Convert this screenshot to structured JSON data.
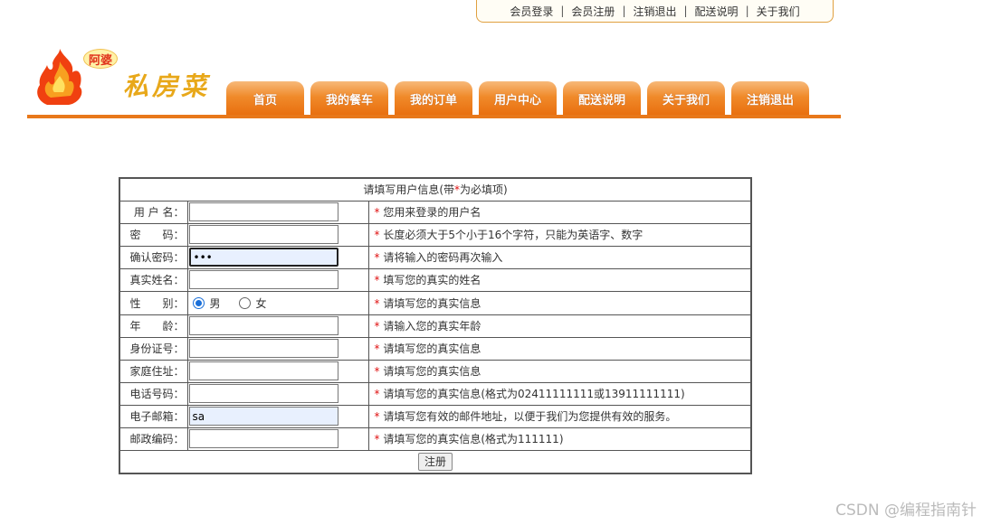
{
  "toplinks": [
    "会员登录",
    "会员注册",
    "注销退出",
    "配送说明",
    "关于我们"
  ],
  "toplink_sep": "|",
  "logo": {
    "tag": "阿婆",
    "name": "私房菜"
  },
  "nav": [
    "首页",
    "我的餐车",
    "我的订单",
    "用户中心",
    "配送说明",
    "关于我们",
    "注销退出"
  ],
  "form": {
    "caption_pre": "请填写用户信息(带",
    "caption_star": "*",
    "caption_post": "为必填项)",
    "star": "*",
    "rows": [
      {
        "label": "用 户 名：",
        "value": "",
        "hint": "您用来登录的用户名"
      },
      {
        "label": "密　　码：",
        "value": "",
        "hint": "长度必须大于5个小于16个字符，只能为英语字、数字"
      },
      {
        "label": "确认密码：",
        "value": "•••",
        "hint": "请将输入的密码再次输入"
      },
      {
        "label": "真实姓名：",
        "value": "",
        "hint": "填写您的真实的姓名"
      },
      {
        "label": "性　　别：",
        "hint": "请填写您的真实信息"
      },
      {
        "label": "年　　龄：",
        "value": "",
        "hint": "请输入您的真实年龄"
      },
      {
        "label": "身份证号：",
        "value": "",
        "hint": "请填写您的真实信息"
      },
      {
        "label": "家庭住址：",
        "value": "",
        "hint": "请填写您的真实信息"
      },
      {
        "label": "电话号码：",
        "value": "",
        "hint": "请填写您的真实信息(格式为02411111111或13911111111)"
      },
      {
        "label": "电子邮箱：",
        "value": "sa",
        "hint": "请填写您有效的邮件地址，以便于我们为您提供有效的服务。"
      },
      {
        "label": "邮政编码：",
        "value": "",
        "hint": "请填写您的真实信息(格式为111111)"
      }
    ],
    "gender": {
      "male": "男",
      "female": "女",
      "selected": "男"
    },
    "submit": "注册"
  },
  "watermark": "CSDN @编程指南针",
  "colors": {
    "accent": "#e8781a",
    "star": "#e01010"
  }
}
